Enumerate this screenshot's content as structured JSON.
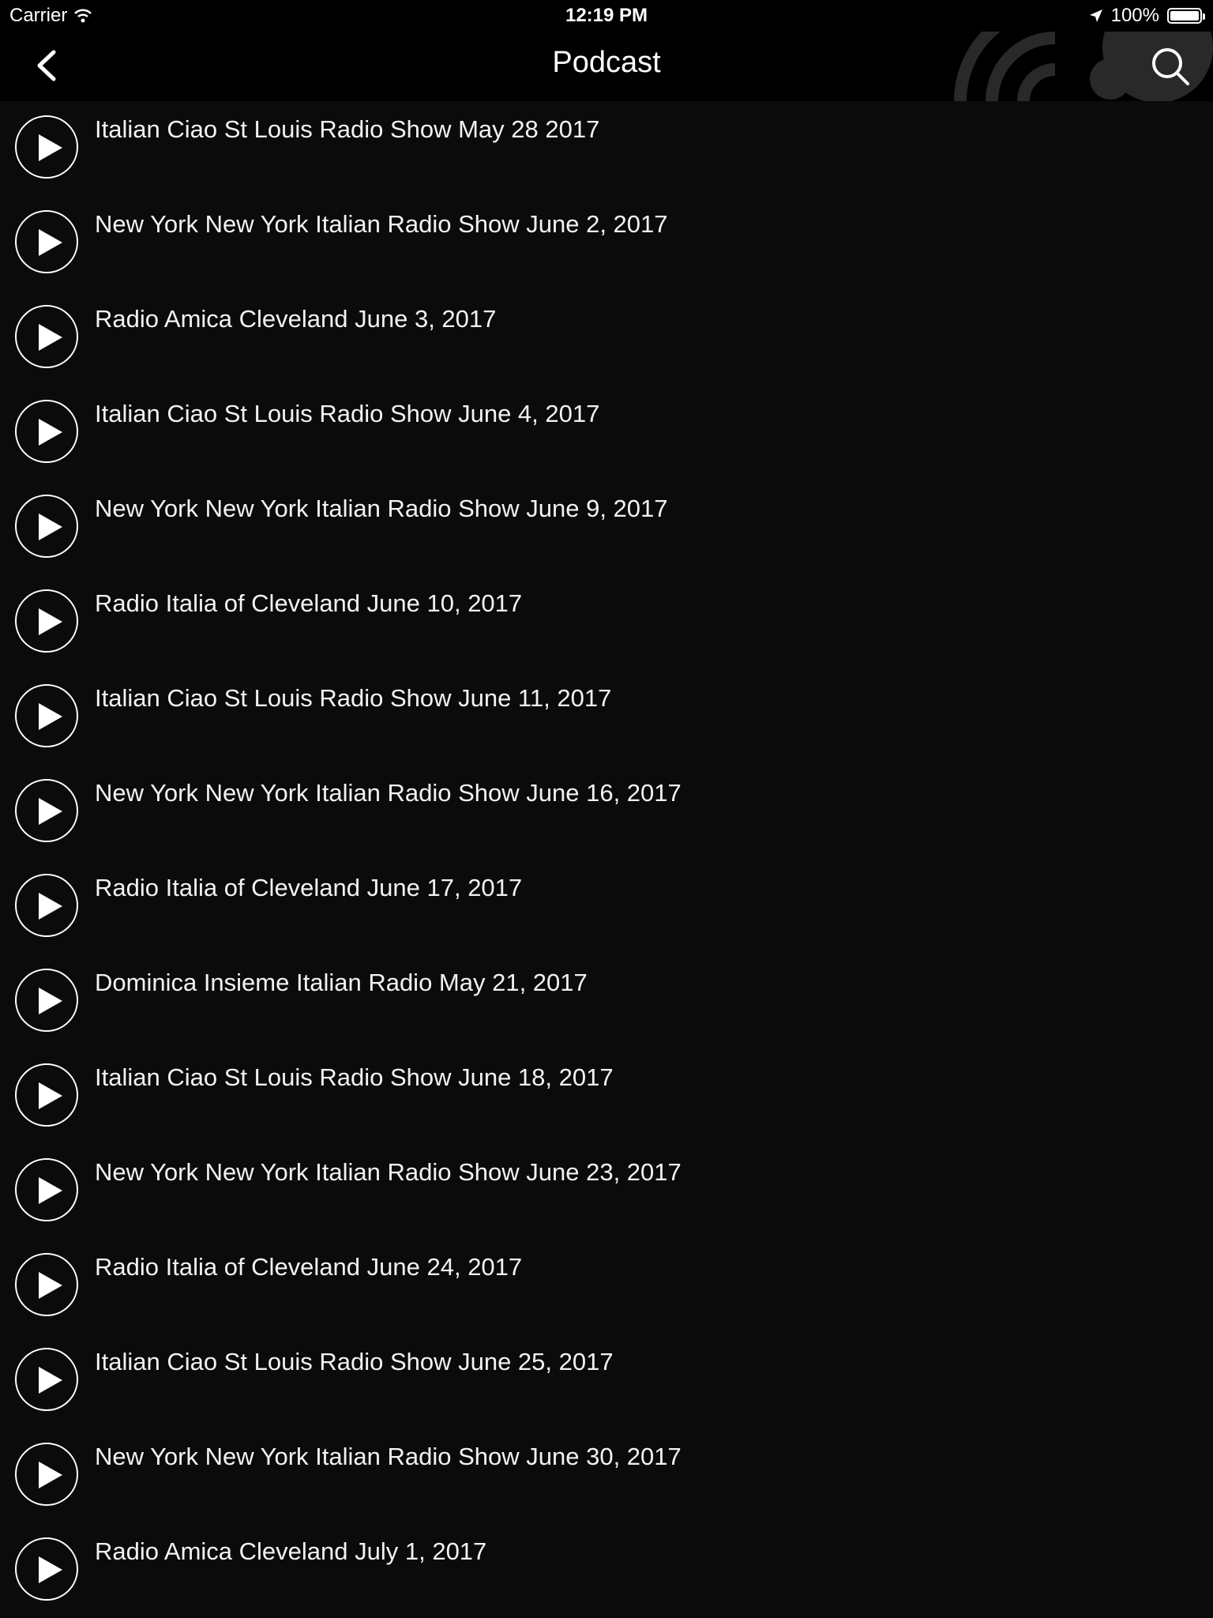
{
  "status_bar": {
    "carrier": "Carrier",
    "time": "12:19 PM",
    "battery_percent": "100%",
    "battery_level": 1.0
  },
  "nav": {
    "title": "Podcast",
    "back_icon": "chevron-left-icon",
    "search_icon": "search-icon"
  },
  "episodes": [
    {
      "title": "Italian Ciao St Louis Radio Show May 28 2017"
    },
    {
      "title": "New York New York Italian Radio Show June 2, 2017"
    },
    {
      "title": "Radio Amica Cleveland June 3, 2017"
    },
    {
      "title": "Italian Ciao St Louis Radio Show June 4, 2017"
    },
    {
      "title": "New York New York Italian Radio Show June 9, 2017"
    },
    {
      "title": "Radio Italia of Cleveland June 10, 2017"
    },
    {
      "title": "Italian Ciao St Louis Radio Show June 11, 2017"
    },
    {
      "title": "New York New York Italian Radio Show June 16, 2017"
    },
    {
      "title": "Radio Italia of Cleveland June 17, 2017"
    },
    {
      "title": "Dominica Insieme Italian Radio May 21, 2017"
    },
    {
      "title": "Italian Ciao St Louis Radio Show June 18, 2017"
    },
    {
      "title": "New York New York Italian Radio Show June 23, 2017"
    },
    {
      "title": "Radio Italia of Cleveland June 24, 2017"
    },
    {
      "title": "Italian Ciao St Louis Radio Show June 25, 2017"
    },
    {
      "title": "New York New York Italian Radio Show June 30, 2017"
    },
    {
      "title": "Radio Amica Cleveland July 1, 2017"
    }
  ],
  "colors": {
    "background": "#0b0b0b",
    "nav_background": "#000000",
    "text": "#ffffff"
  }
}
